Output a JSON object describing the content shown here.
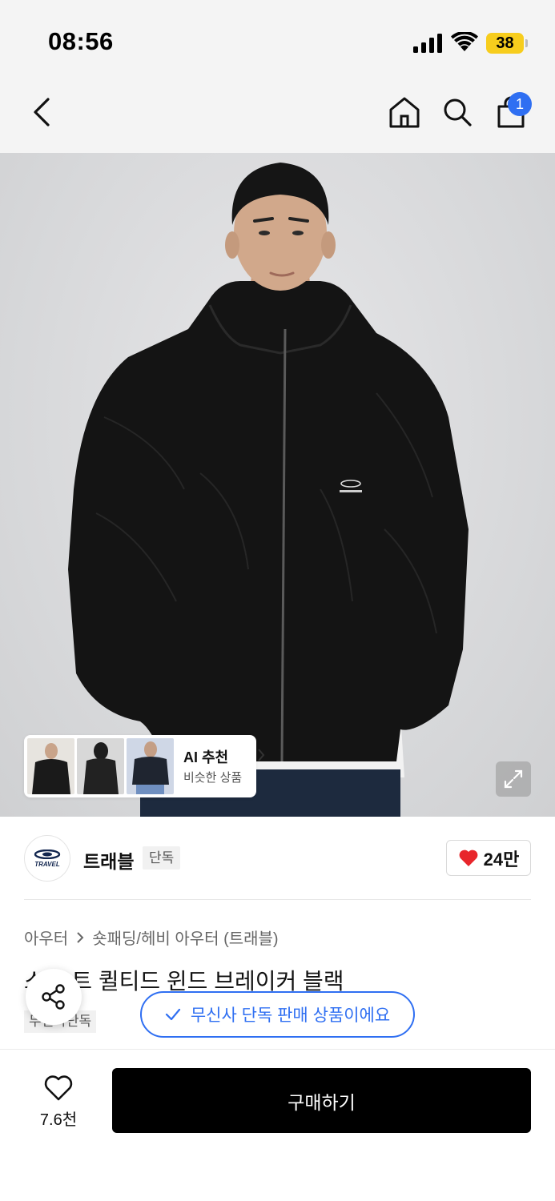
{
  "status_bar": {
    "time": "08:56",
    "battery": "38",
    "battery_color": "#f7cd1d"
  },
  "nav": {
    "back_icon": "chevron-left-icon",
    "home_icon": "home-icon",
    "search_icon": "search-icon",
    "cart_icon": "shopping-bag-icon",
    "cart_badge": "1",
    "badge_color": "#2f6ff2"
  },
  "ai_recommend": {
    "title": "AI 추천",
    "subtitle": "비슷한 상품"
  },
  "brand": {
    "logo_text": "TRAVEL",
    "name": "트래블",
    "tag": "단독",
    "likes": "24만",
    "like_color": "#e8262b"
  },
  "breadcrumb": {
    "items": [
      "아우터",
      "숏패딩/헤비 아우터 (트래블)"
    ]
  },
  "product": {
    "title": "스 우트 퀼티드 윈드 브레이커 블랙",
    "tag": "무신사단독"
  },
  "notice": {
    "text": "무신사 단독 판매 상품이에요",
    "color": "#2f6ff2"
  },
  "bottom": {
    "wish_count": "7.6천",
    "buy_label": "구매하기"
  }
}
